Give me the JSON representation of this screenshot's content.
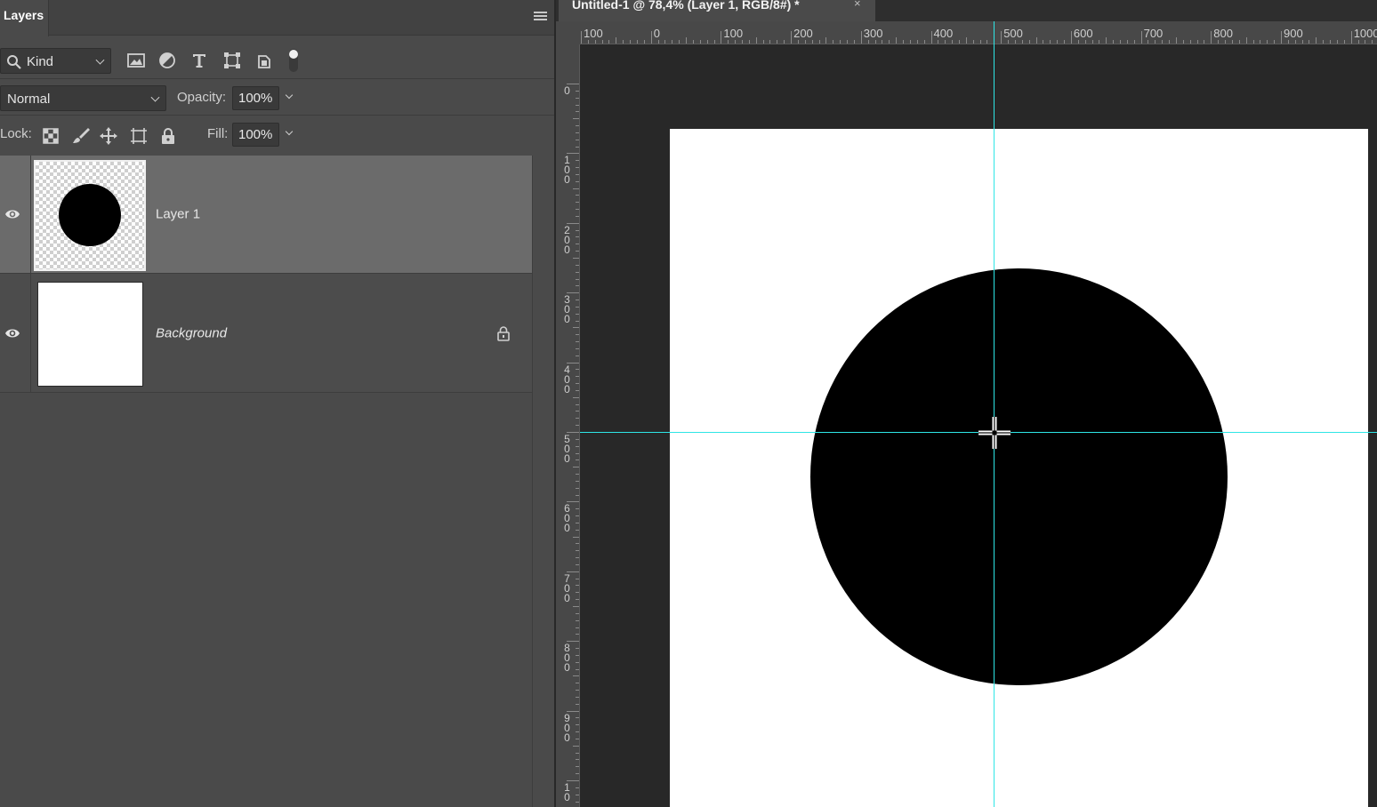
{
  "layers_panel": {
    "tab_title": "Layers",
    "filter_kind": "Kind",
    "blend_mode": "Normal",
    "opacity_label": "Opacity:",
    "opacity_value": "100%",
    "lock_label": "Lock:",
    "fill_label": "Fill:",
    "fill_value": "100%",
    "layers": [
      {
        "name": "Layer 1",
        "visible": true,
        "selected": true,
        "locked": false
      },
      {
        "name": "Background",
        "visible": true,
        "selected": false,
        "locked": true
      }
    ]
  },
  "document": {
    "tab_title": "Untitled-1 @ 78,4% (Layer 1, RGB/8#) *",
    "close_glyph": "×",
    "ruler_h": [
      "100",
      "0",
      "100",
      "200",
      "300",
      "400",
      "500",
      "600",
      "700",
      "800",
      "900",
      "1000"
    ],
    "ruler_v": [
      "0",
      "100",
      "200",
      "300",
      "400",
      "500",
      "600",
      "700",
      "800",
      "900",
      "10"
    ],
    "canvas_color": "#ffffff",
    "shape_color": "#000000",
    "guide_color": "#2ee6e6"
  }
}
